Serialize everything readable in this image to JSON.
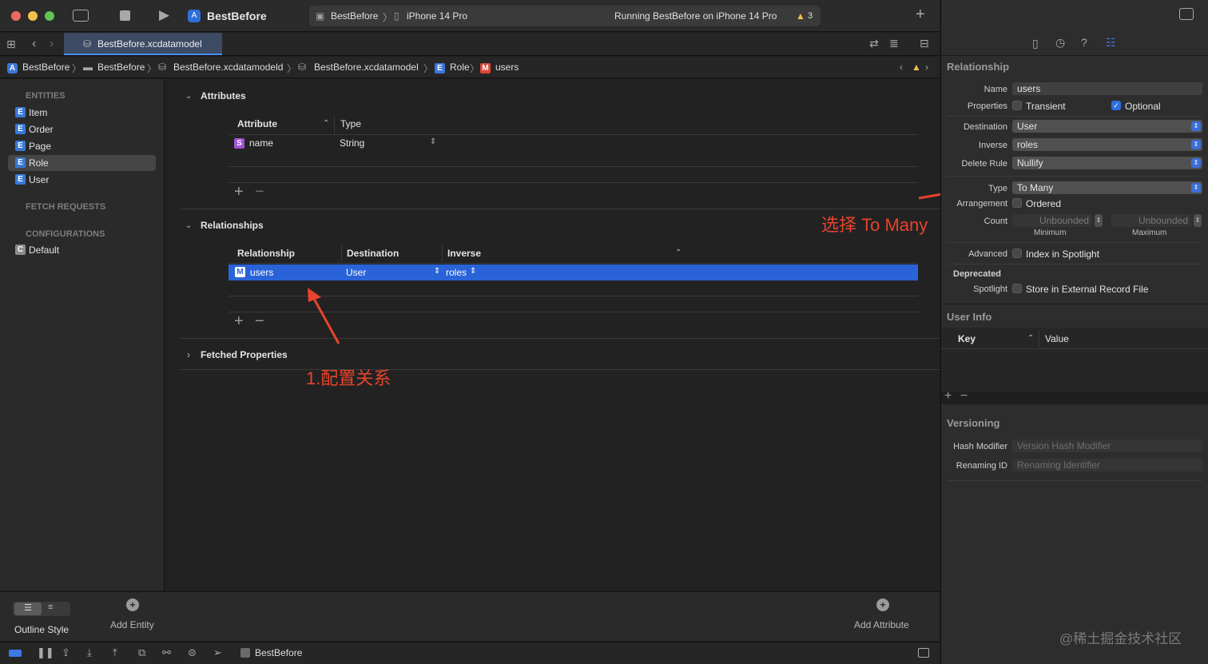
{
  "titlebar": {
    "app_name": "BestBefore",
    "scheme_project": "BestBefore",
    "scheme_device": "iPhone 14 Pro",
    "run_status": "Running BestBefore on iPhone 14 Pro",
    "warning_count": "3",
    "add_label": "+"
  },
  "tab": {
    "label": "BestBefore.xcdatamodel"
  },
  "breadcrumb": [
    "BestBefore",
    "BestBefore",
    "BestBefore.xcdatamodeld",
    "BestBefore.xcdatamodel",
    "Role",
    "users"
  ],
  "sidebar": {
    "entities_header": "ENTITIES",
    "entities": [
      {
        "badge": "E",
        "label": "Item"
      },
      {
        "badge": "E",
        "label": "Order"
      },
      {
        "badge": "E",
        "label": "Page"
      },
      {
        "badge": "E",
        "label": "Role"
      },
      {
        "badge": "E",
        "label": "User"
      }
    ],
    "fetch_header": "FETCH REQUESTS",
    "config_header": "CONFIGURATIONS",
    "configurations": [
      {
        "badge": "C",
        "label": "Default"
      }
    ]
  },
  "attributes": {
    "title": "Attributes",
    "col_attribute": "Attribute",
    "col_type": "Type",
    "rows": [
      {
        "badge": "S",
        "name": "name",
        "type": "String"
      }
    ]
  },
  "relationships": {
    "title": "Relationships",
    "col_relationship": "Relationship",
    "col_destination": "Destination",
    "col_inverse": "Inverse",
    "rows": [
      {
        "badge": "M",
        "name": "users",
        "destination": "User",
        "inverse": "roles"
      }
    ]
  },
  "fetched_properties": {
    "title": "Fetched Properties"
  },
  "annotations": {
    "configure": "1.配置关系",
    "select_to_many": "选择 To Many"
  },
  "bottom": {
    "outline_style": "Outline Style",
    "add_entity": "Add Entity",
    "add_attribute": "Add Attribute"
  },
  "statusbar": {
    "target": "BestBefore"
  },
  "inspector": {
    "relationship_header": "Relationship",
    "name_label": "Name",
    "name_value": "users",
    "properties_label": "Properties",
    "transient": "Transient",
    "optional": "Optional",
    "destination_label": "Destination",
    "destination_value": "User",
    "inverse_label": "Inverse",
    "inverse_value": "roles",
    "delete_rule_label": "Delete Rule",
    "delete_rule_value": "Nullify",
    "type_label": "Type",
    "type_value": "To Many",
    "arrangement_label": "Arrangement",
    "ordered": "Ordered",
    "count_label": "Count",
    "min_placeholder": "Unbounded",
    "max_placeholder": "Unbounded",
    "minimum": "Minimum",
    "maximum": "Maximum",
    "advanced_label": "Advanced",
    "index_spotlight": "Index in Spotlight",
    "deprecated_label": "Deprecated",
    "spotlight_label": "Spotlight",
    "store_external": "Store in External Record File",
    "user_info_header": "User Info",
    "key_col": "Key",
    "value_col": "Value",
    "versioning_header": "Versioning",
    "hash_label": "Hash Modifier",
    "hash_placeholder": "Version Hash Modifier",
    "renaming_label": "Renaming ID",
    "renaming_placeholder": "Renaming Identifier"
  },
  "watermark": "@稀土掘金技术社区"
}
